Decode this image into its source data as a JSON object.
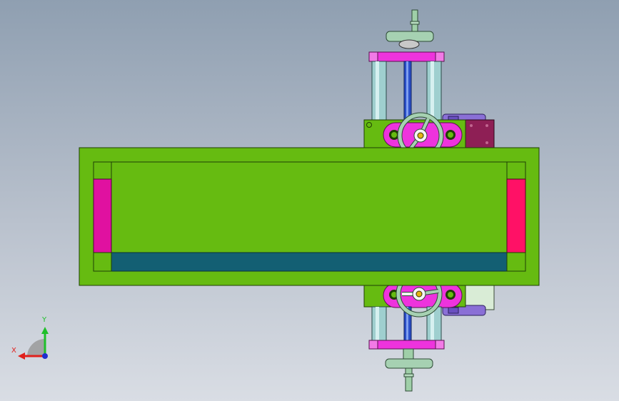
{
  "triad": {
    "x_label": "X",
    "y_label": "Y",
    "x_color": "#e0201c",
    "y_color": "#1fbf2a",
    "z_color": "#1f2fd0"
  },
  "colors": {
    "table": "#66bb11",
    "slot": "#135f73",
    "end_block_left": "#e011a0",
    "end_block_right": "#ff1166",
    "bracket": "#ee33dd",
    "rod": "#9fcfcf",
    "screw": "#2a4fc8",
    "handwheel": "#a6d1b2",
    "motor": "#8a6fd6",
    "plate": "#8e1f55"
  }
}
